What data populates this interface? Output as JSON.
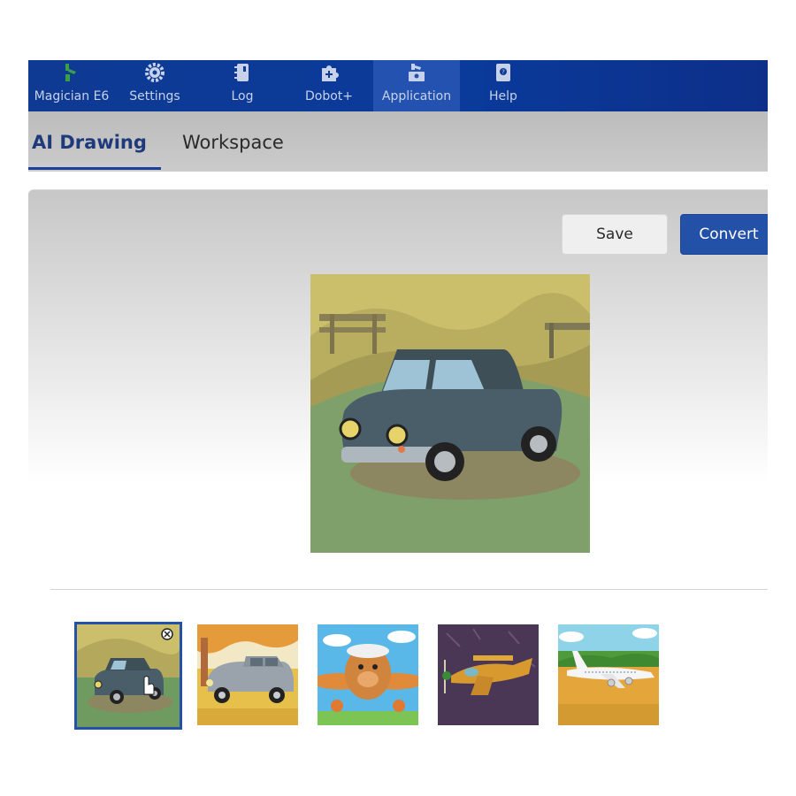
{
  "nav": {
    "items": [
      {
        "label": "Magician E6",
        "icon": "robot-arm-icon"
      },
      {
        "label": "Settings",
        "icon": "gear-icon"
      },
      {
        "label": "Log",
        "icon": "notebook-icon"
      },
      {
        "label": "Dobot+",
        "icon": "puzzle-plus-icon"
      },
      {
        "label": "Application",
        "icon": "application-icon",
        "active": true
      },
      {
        "label": "Help",
        "icon": "help-book-icon"
      }
    ]
  },
  "tabs": {
    "ai_drawing": "AI Drawing",
    "workspace": "Workspace",
    "active": "AI Drawing"
  },
  "toolbar": {
    "save_label": "Save",
    "convert_label": "Convert"
  },
  "preview": {
    "subject": "cartoon blue car"
  },
  "gallery": {
    "items": [
      {
        "subject": "cartoon blue car",
        "selected": true
      },
      {
        "subject": "cartoon silver car"
      },
      {
        "subject": "cartoon cute airplane"
      },
      {
        "subject": "cartoon orange airplane"
      },
      {
        "subject": "cartoon white airliner"
      }
    ]
  },
  "colors": {
    "nav_bg": "#0e3a93",
    "accent": "#2451a8",
    "tab_active_text": "#1e3a7b"
  }
}
